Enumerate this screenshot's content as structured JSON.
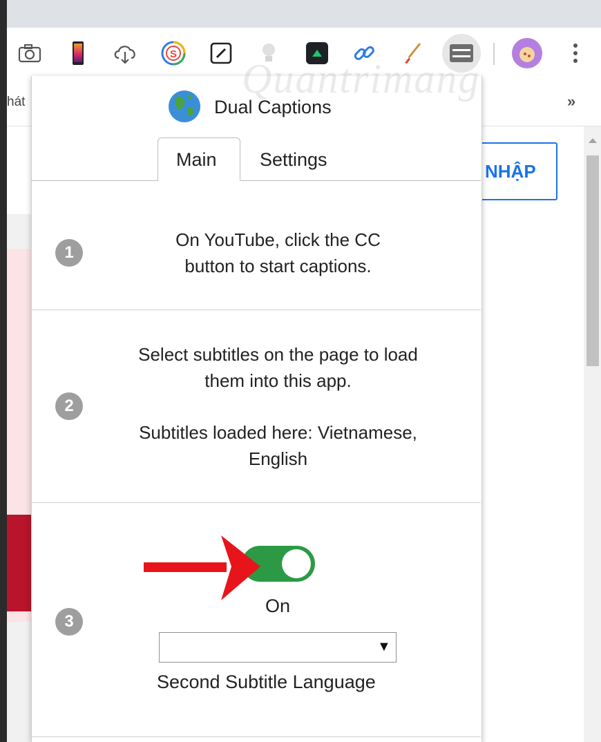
{
  "browser": {
    "bookmark_bar_text": "hát",
    "bookmark_more": "»",
    "toolbar_icons": [
      "camera-icon",
      "phone-icon",
      "cloud-download-icon",
      "s-extension-icon",
      "pen-square-icon",
      "lightbulb-icon",
      "terminal-icon",
      "link-icon",
      "brush-icon",
      "dual-captions-extension-icon",
      "profile-avatar-icon",
      "more-menu-icon"
    ]
  },
  "page": {
    "login_button_label": "NHẬP",
    "watermark_text": "Quantrimang"
  },
  "popup": {
    "title": "Dual Captions",
    "tabs": [
      {
        "label": "Main",
        "active": true
      },
      {
        "label": "Settings",
        "active": false
      }
    ],
    "steps": [
      {
        "number": "1",
        "lines": [
          "On YouTube, click the CC",
          "button to start captions."
        ]
      },
      {
        "number": "2",
        "lines": [
          "Select subtitles on the page to load",
          "them into this app."
        ],
        "loaded_lines": [
          "Subtitles loaded here: Vietnamese,",
          "English"
        ]
      },
      {
        "number": "3",
        "toggle_label": "On",
        "toggle_on": true,
        "select_value": "",
        "select_arrow": "▼",
        "select_caption": "Second Subtitle Language"
      }
    ],
    "toggle_color": "#2c9a45",
    "annotation_arrow_color": "#e8141c"
  }
}
